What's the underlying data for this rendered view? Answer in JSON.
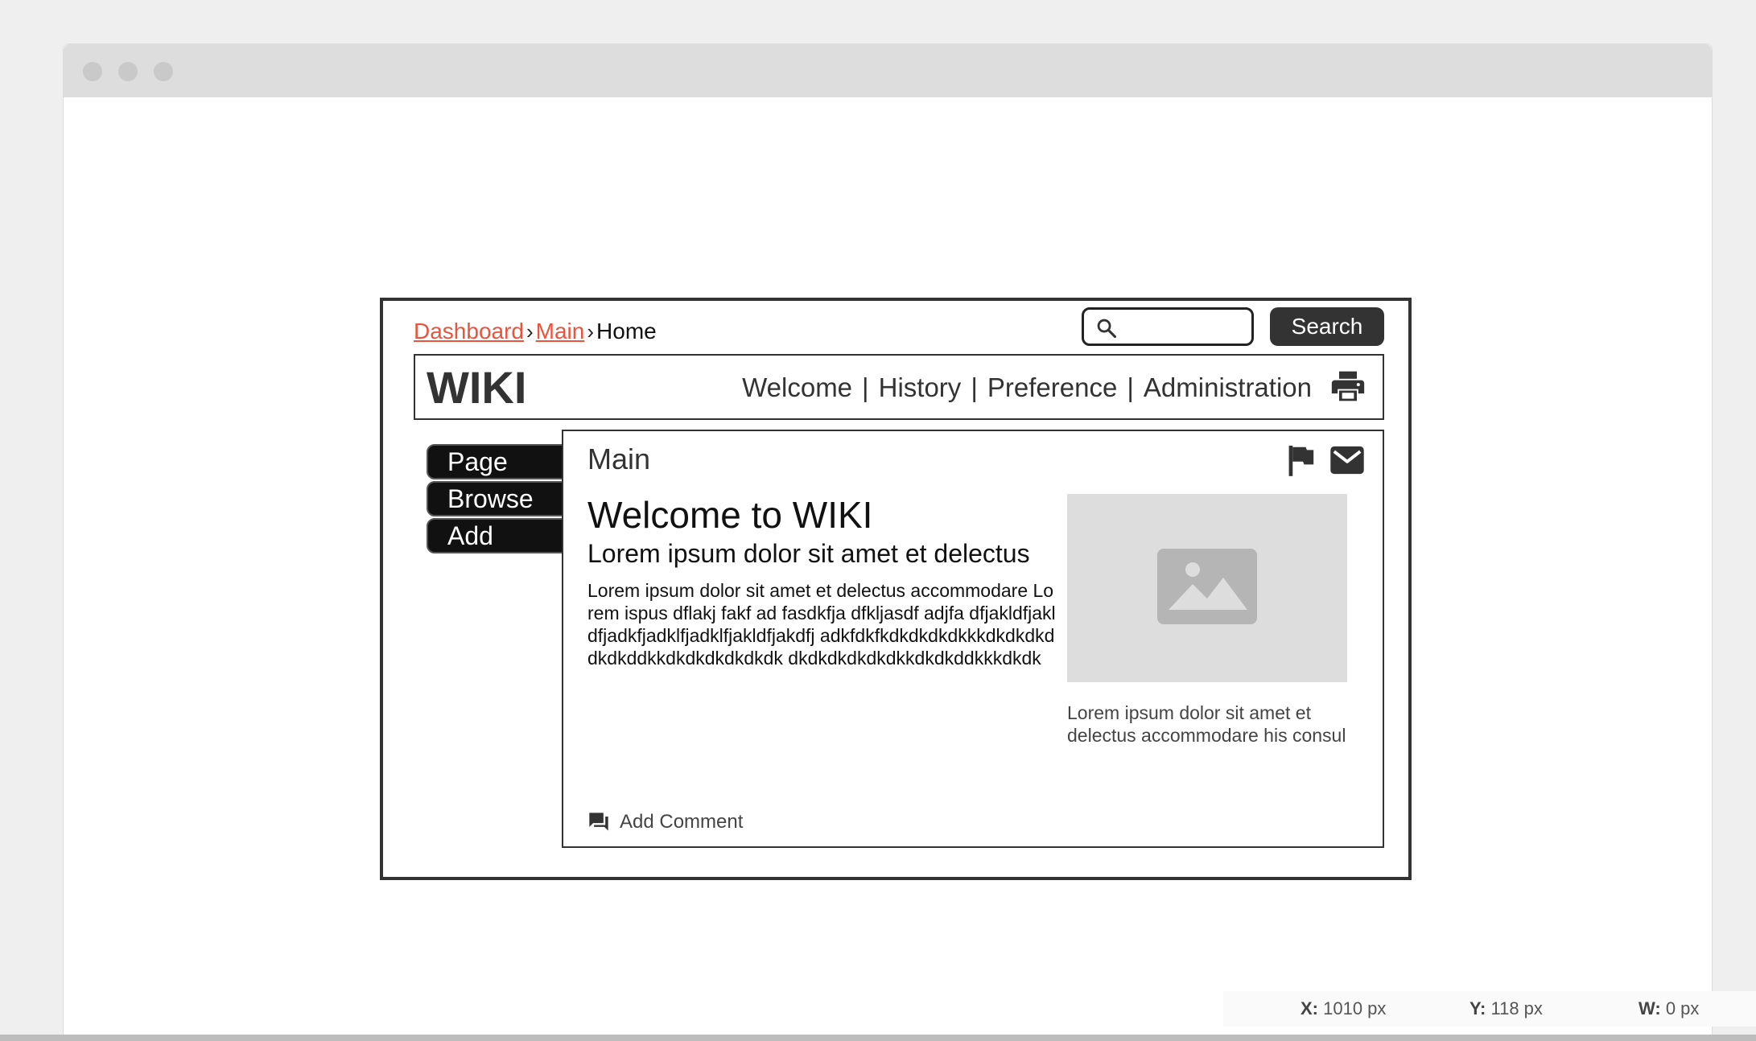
{
  "breadcrumb": {
    "items": [
      "Dashboard",
      "Main"
    ],
    "current": "Home",
    "separator": "›"
  },
  "search": {
    "value": "",
    "placeholder": "",
    "button_label": "Search"
  },
  "header": {
    "logo": "WIKI",
    "nav": [
      "Welcome",
      "History",
      "Preference",
      "Administration"
    ],
    "pipe": "|"
  },
  "sidebar": {
    "tabs": [
      "Page",
      "Browse",
      "Add"
    ]
  },
  "content": {
    "title": "Main",
    "heading": "Welcome to WIKI",
    "subheading": "Lorem ipsum dolor sit amet et delectus",
    "body": "Lorem ipsum dolor sit amet et delectus accommodare Lorem ispus dflakj fakf ad fasdkfja dfkljasdf adjfa dfjakldfjakldfjadkfjadklfjadklfjakldfjakdfj adkfdkfkdkdkdkdkkkdkdkdkddkdkddkkdkdkdkdkdkdk dkdkdkdkdkdkkdkdkddkkkdkdk",
    "image_caption": "Lorem ipsum dolor sit amet et delectus accommodare his consul",
    "add_comment": "Add Comment"
  },
  "status": {
    "x_label": "X:",
    "x_value": "1010 px",
    "y_label": "Y:",
    "y_value": "118 px",
    "w_label": "W:",
    "w_value": "0 px"
  },
  "colors": {
    "link": "#e8543d",
    "dark": "#333333",
    "tab_bg": "#111111",
    "placeholder_bg": "#dddddd"
  },
  "icons": [
    "search-icon",
    "print-icon",
    "flag-icon",
    "mail-icon",
    "comment-icon",
    "image-icon"
  ]
}
